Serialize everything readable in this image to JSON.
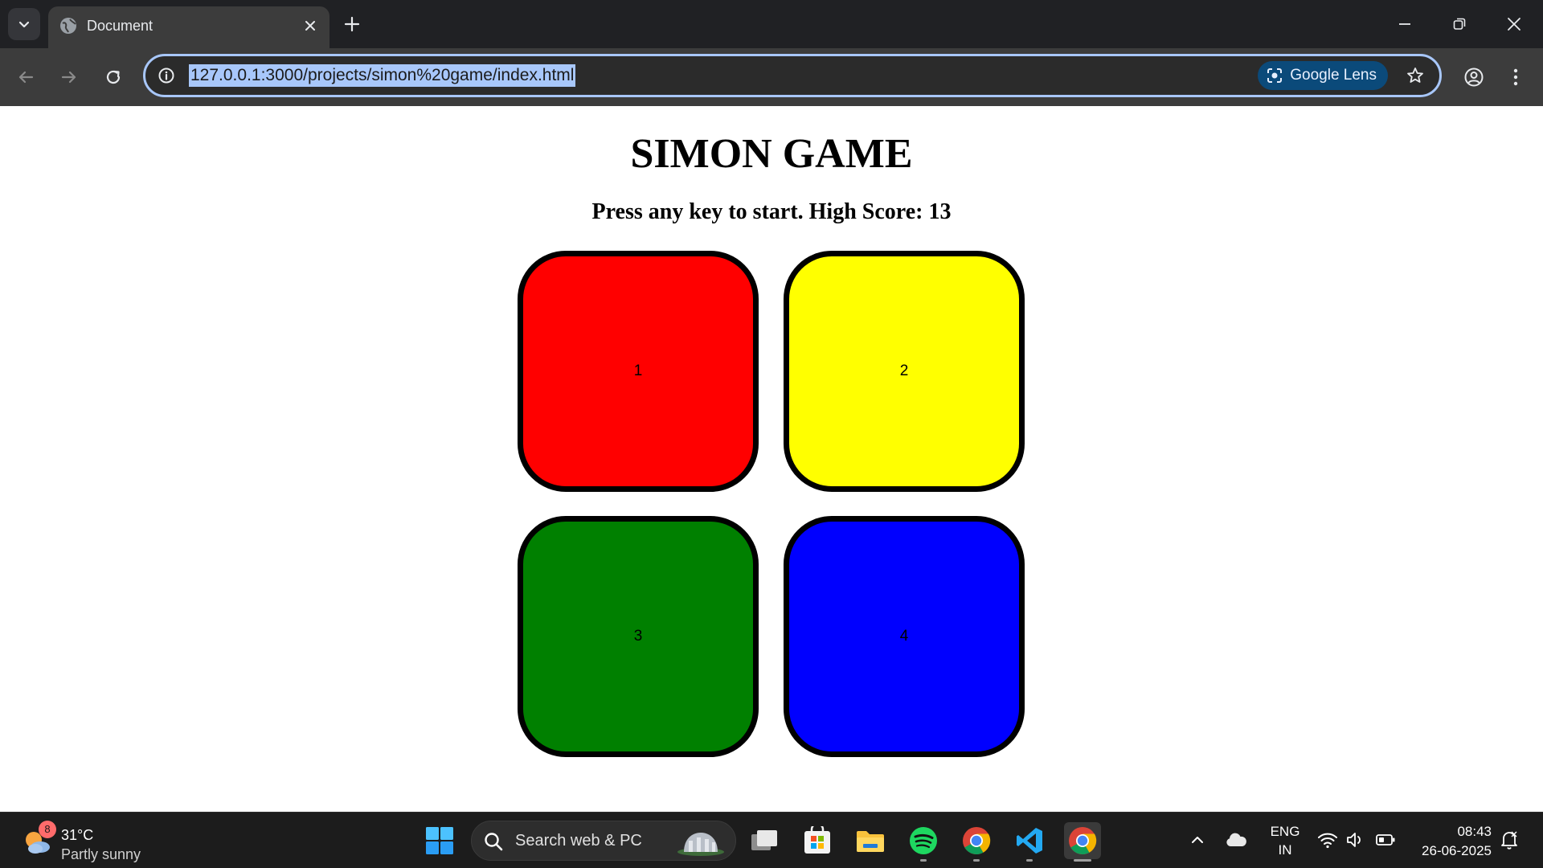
{
  "browser": {
    "tab_title": "Document",
    "url": "127.0.0.1:3000/projects/simon%20game/index.html",
    "lens_label": "Google Lens"
  },
  "page": {
    "title": "SIMON GAME",
    "status": "Press any key to start. High Score: 13",
    "pads": [
      {
        "label": "1",
        "color": "#ff0000"
      },
      {
        "label": "2",
        "color": "#ffff00"
      },
      {
        "label": "3",
        "color": "#008000"
      },
      {
        "label": "4",
        "color": "#0000ff"
      }
    ]
  },
  "taskbar": {
    "weather_badge": "8",
    "weather_temp": "31°C",
    "weather_desc": "Partly sunny",
    "search_placeholder": "Search web & PC",
    "lang_line1": "ENG",
    "lang_line2": "IN",
    "time": "08:43",
    "date": "26-06-2025"
  },
  "icons": {
    "tab_search": "chevron-down-icon",
    "favicon": "globe-icon",
    "tab_close": "close-icon",
    "new_tab": "plus-icon",
    "minimize": "minimize-icon",
    "restore": "restore-icon",
    "close_window": "close-window-icon",
    "back": "back-arrow-icon",
    "forward": "forward-arrow-icon",
    "reload": "reload-icon",
    "site_info": "info-icon",
    "lens": "google-lens-icon",
    "bookmark": "star-icon",
    "profile": "profile-icon",
    "menu": "kebab-menu-icon"
  },
  "colors": {
    "chrome_dark": "#202124",
    "toolbar": "#3c3c3c",
    "omnibox_focus": "#a8c7fa",
    "taskbar": "#1c1c1c"
  }
}
